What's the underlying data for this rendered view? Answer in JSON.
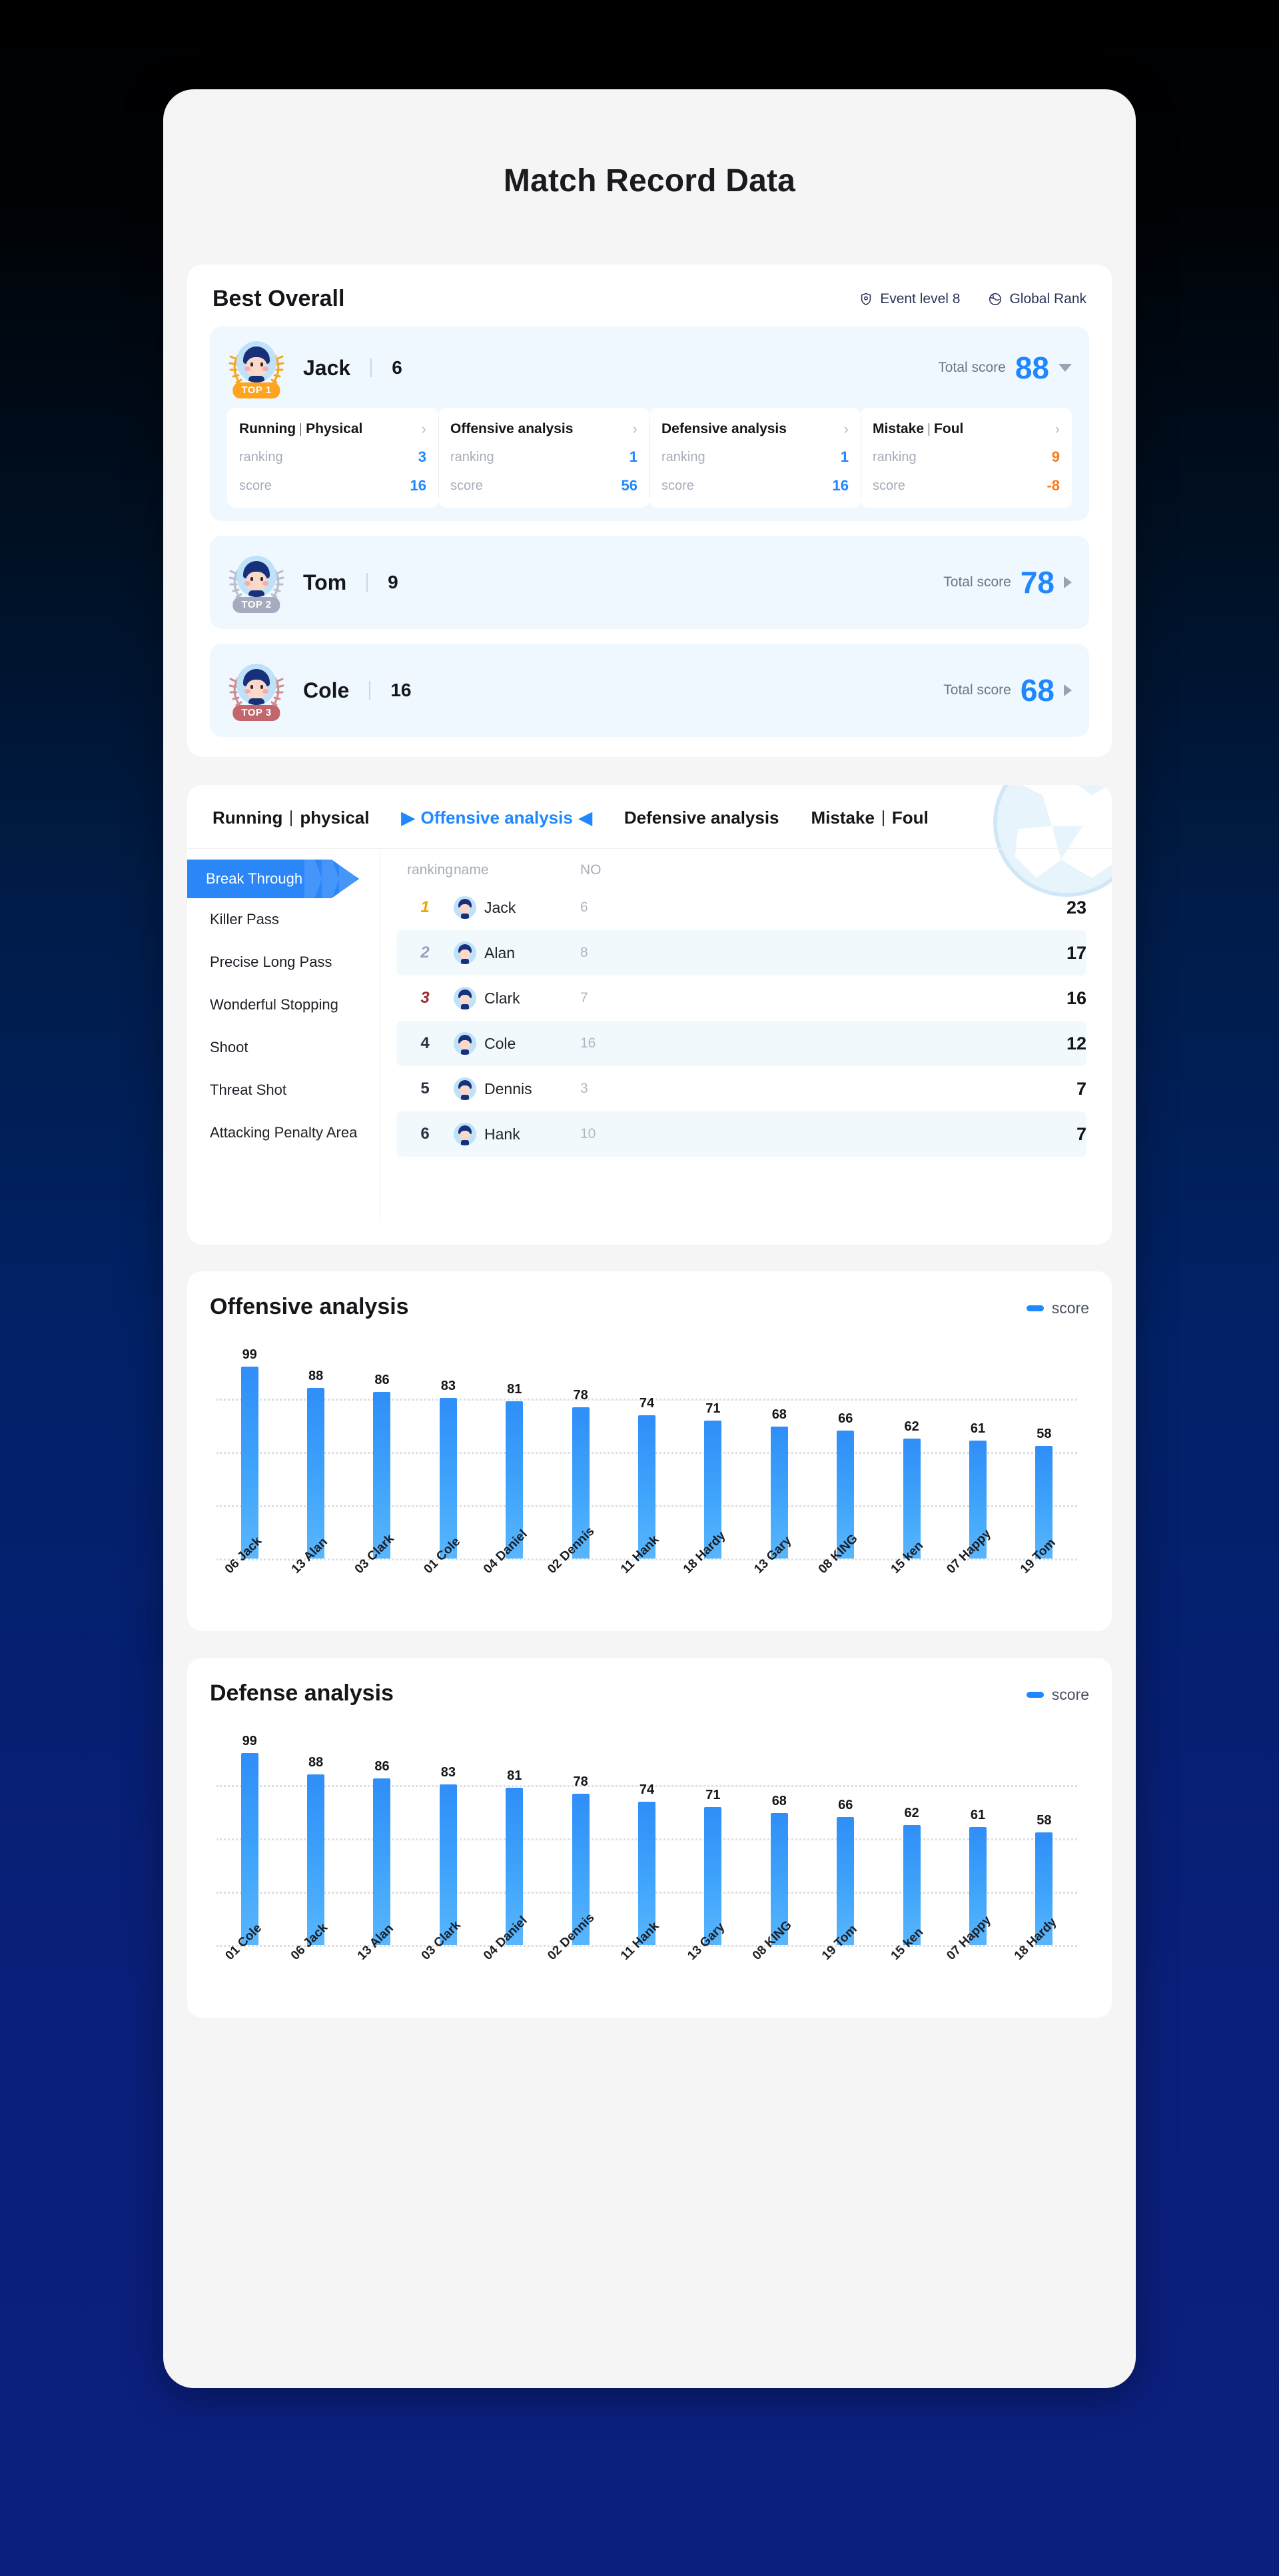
{
  "page": {
    "title": "Match Record Data"
  },
  "best_overall": {
    "title": "Best Overall",
    "meta": [
      {
        "icon": "shield-icon",
        "label": "Event level 8"
      },
      {
        "icon": "globe-icon",
        "label": "Global Rank"
      }
    ],
    "score_label": "Total score",
    "players": [
      {
        "name": "Jack",
        "no": "6",
        "badge": "TOP 1",
        "total_score": "88",
        "expanded": true,
        "stats": [
          {
            "title_a": "Running",
            "title_b": "Physical",
            "ranking_label": "ranking",
            "ranking": "3",
            "score_label": "score",
            "score": "16",
            "negative": false
          },
          {
            "title_a": "Offensive analysis",
            "title_b": "",
            "ranking_label": "ranking",
            "ranking": "1",
            "score_label": "score",
            "score": "56",
            "negative": false
          },
          {
            "title_a": "Defensive analysis",
            "title_b": "",
            "ranking_label": "ranking",
            "ranking": "1",
            "score_label": "score",
            "score": "16",
            "negative": false
          },
          {
            "title_a": "Mistake",
            "title_b": "Foul",
            "ranking_label": "ranking",
            "ranking": "9",
            "score_label": "score",
            "score": "-8",
            "negative": true
          }
        ]
      },
      {
        "name": "Tom",
        "no": "9",
        "badge": "TOP 2",
        "total_score": "78",
        "expanded": false
      },
      {
        "name": "Cole",
        "no": "16",
        "badge": "TOP 3",
        "total_score": "68",
        "expanded": false
      }
    ]
  },
  "ranking_panel": {
    "tabs": [
      {
        "label_a": "Running",
        "label_b": "physical",
        "active": false
      },
      {
        "label_a": "Offensive analysis",
        "label_b": "",
        "active": true
      },
      {
        "label_a": "Defensive analysis",
        "label_b": "",
        "active": false
      },
      {
        "label_a": "Mistake",
        "label_b": "Foul",
        "active": false
      }
    ],
    "side_items": [
      {
        "label": "Break Through",
        "active": true
      },
      {
        "label": "Killer Pass",
        "active": false
      },
      {
        "label": "Precise Long Pass",
        "active": false
      },
      {
        "label": "Wonderful Stopping",
        "active": false
      },
      {
        "label": "Shoot",
        "active": false
      },
      {
        "label": "Threat Shot",
        "active": false
      },
      {
        "label": "Attacking Penalty Area",
        "active": false
      }
    ],
    "columns": [
      "ranking",
      "name",
      "NO",
      ""
    ],
    "rows": [
      {
        "rank": "1",
        "name": "Jack",
        "no": "6",
        "value": "23"
      },
      {
        "rank": "2",
        "name": "Alan",
        "no": "8",
        "value": "17"
      },
      {
        "rank": "3",
        "name": "Clark",
        "no": "7",
        "value": "16"
      },
      {
        "rank": "4",
        "name": "Cole",
        "no": "16",
        "value": "12"
      },
      {
        "rank": "5",
        "name": "Dennis",
        "no": "3",
        "value": "7"
      },
      {
        "rank": "6",
        "name": "Hank",
        "no": "10",
        "value": "7"
      }
    ]
  },
  "chart_data": [
    {
      "type": "bar",
      "title": "Offensive analysis",
      "xlabel": "",
      "ylabel": "",
      "ylim": [
        0,
        110
      ],
      "grid": true,
      "legend_position": "top-right",
      "legend": [
        "score"
      ],
      "series": [
        {
          "name": "score",
          "values": [
            99,
            88,
            86,
            83,
            81,
            78,
            74,
            71,
            68,
            66,
            62,
            61,
            58
          ]
        }
      ],
      "categories": [
        "06 Jack",
        "13 Alan",
        "03 Clark",
        "01 Cole",
        "04 Daniel",
        "02 Dennis",
        "11 Hank",
        "18 Hardy",
        "13 Gary",
        "08 KING",
        "15 ken",
        "07 Happy",
        "19 Tom"
      ]
    },
    {
      "type": "bar",
      "title": "Defense analysis",
      "xlabel": "",
      "ylabel": "",
      "ylim": [
        0,
        110
      ],
      "grid": true,
      "legend_position": "top-right",
      "legend": [
        "score"
      ],
      "series": [
        {
          "name": "score",
          "values": [
            99,
            88,
            86,
            83,
            81,
            78,
            74,
            71,
            68,
            66,
            62,
            61,
            58
          ]
        }
      ],
      "categories": [
        "01 Cole",
        "06 Jack",
        "13 Alan",
        "03 Clark",
        "04 Daniel",
        "02 Dennis",
        "11 Hank",
        "13 Gary",
        "08 KING",
        "19 Tom",
        "15 ken",
        "07 Happy",
        "18 Hardy"
      ]
    }
  ],
  "colors": {
    "accent": "#1f87ff",
    "bar": "#3fa4fb",
    "warn": "#ff7a18",
    "gold": "#ffa41c",
    "silver": "#a6abc0",
    "bronze": "#c1676b",
    "bg_top": "#000000",
    "bg_bottom": "#0b1f7e"
  }
}
